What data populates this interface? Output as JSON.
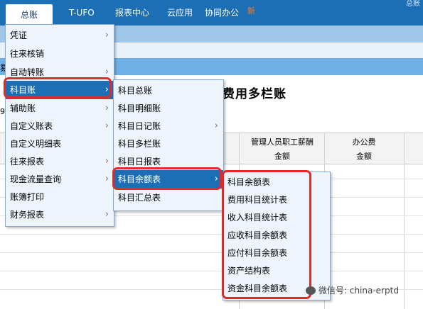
{
  "menubar": {
    "tabs": [
      {
        "label": "总账"
      },
      {
        "label": "T-UFO"
      },
      {
        "label": "报表中心"
      },
      {
        "label": "云应用"
      },
      {
        "label": "协同办公"
      }
    ],
    "new_badge": "新",
    "top_right_fragment": "总账"
  },
  "background": {
    "clipped_label": "易",
    "left_number": "9",
    "report_title": "费用多栏账",
    "columns": [
      {
        "header": "管理人员职工薪酬",
        "sub": "金额"
      },
      {
        "header": "办公费",
        "sub": "金额"
      }
    ]
  },
  "menu_main": {
    "items": [
      {
        "label": "凭证",
        "has_submenu": true
      },
      {
        "label": "往来核销",
        "has_submenu": false
      },
      {
        "label": "自动转账",
        "has_submenu": true
      },
      {
        "label": "科目账",
        "has_submenu": true,
        "highlighted": true
      },
      {
        "label": "辅助账",
        "has_submenu": true
      },
      {
        "label": "自定义账表",
        "has_submenu": true
      },
      {
        "label": "自定义明细表",
        "has_submenu": false
      },
      {
        "label": "往来报表",
        "has_submenu": true
      },
      {
        "label": "现金流量查询",
        "has_submenu": true
      },
      {
        "label": "账簿打印",
        "has_submenu": false
      },
      {
        "label": "财务报表",
        "has_submenu": true
      }
    ]
  },
  "menu_ledger": {
    "items": [
      {
        "label": "科目总账",
        "has_submenu": false
      },
      {
        "label": "科目明细账",
        "has_submenu": false
      },
      {
        "label": "科目日记账",
        "has_submenu": true
      },
      {
        "label": "科目多栏账",
        "has_submenu": false
      },
      {
        "label": "科目日报表",
        "has_submenu": false
      },
      {
        "label": "科目余额表",
        "has_submenu": true,
        "highlighted": true
      },
      {
        "label": "科目汇总表",
        "has_submenu": false
      }
    ]
  },
  "menu_balance": {
    "items": [
      {
        "label": "科目余额表"
      },
      {
        "label": "费用科目统计表"
      },
      {
        "label": "收入科目统计表"
      },
      {
        "label": "应收科目余额表"
      },
      {
        "label": "应付科目余额表"
      },
      {
        "label": "资产结构表"
      },
      {
        "label": "资金科目余额表"
      }
    ]
  },
  "watermark": "微信号: china-erptd",
  "colors": {
    "accent": "#1d6fb5",
    "highlight_box": "#e02b2b"
  }
}
